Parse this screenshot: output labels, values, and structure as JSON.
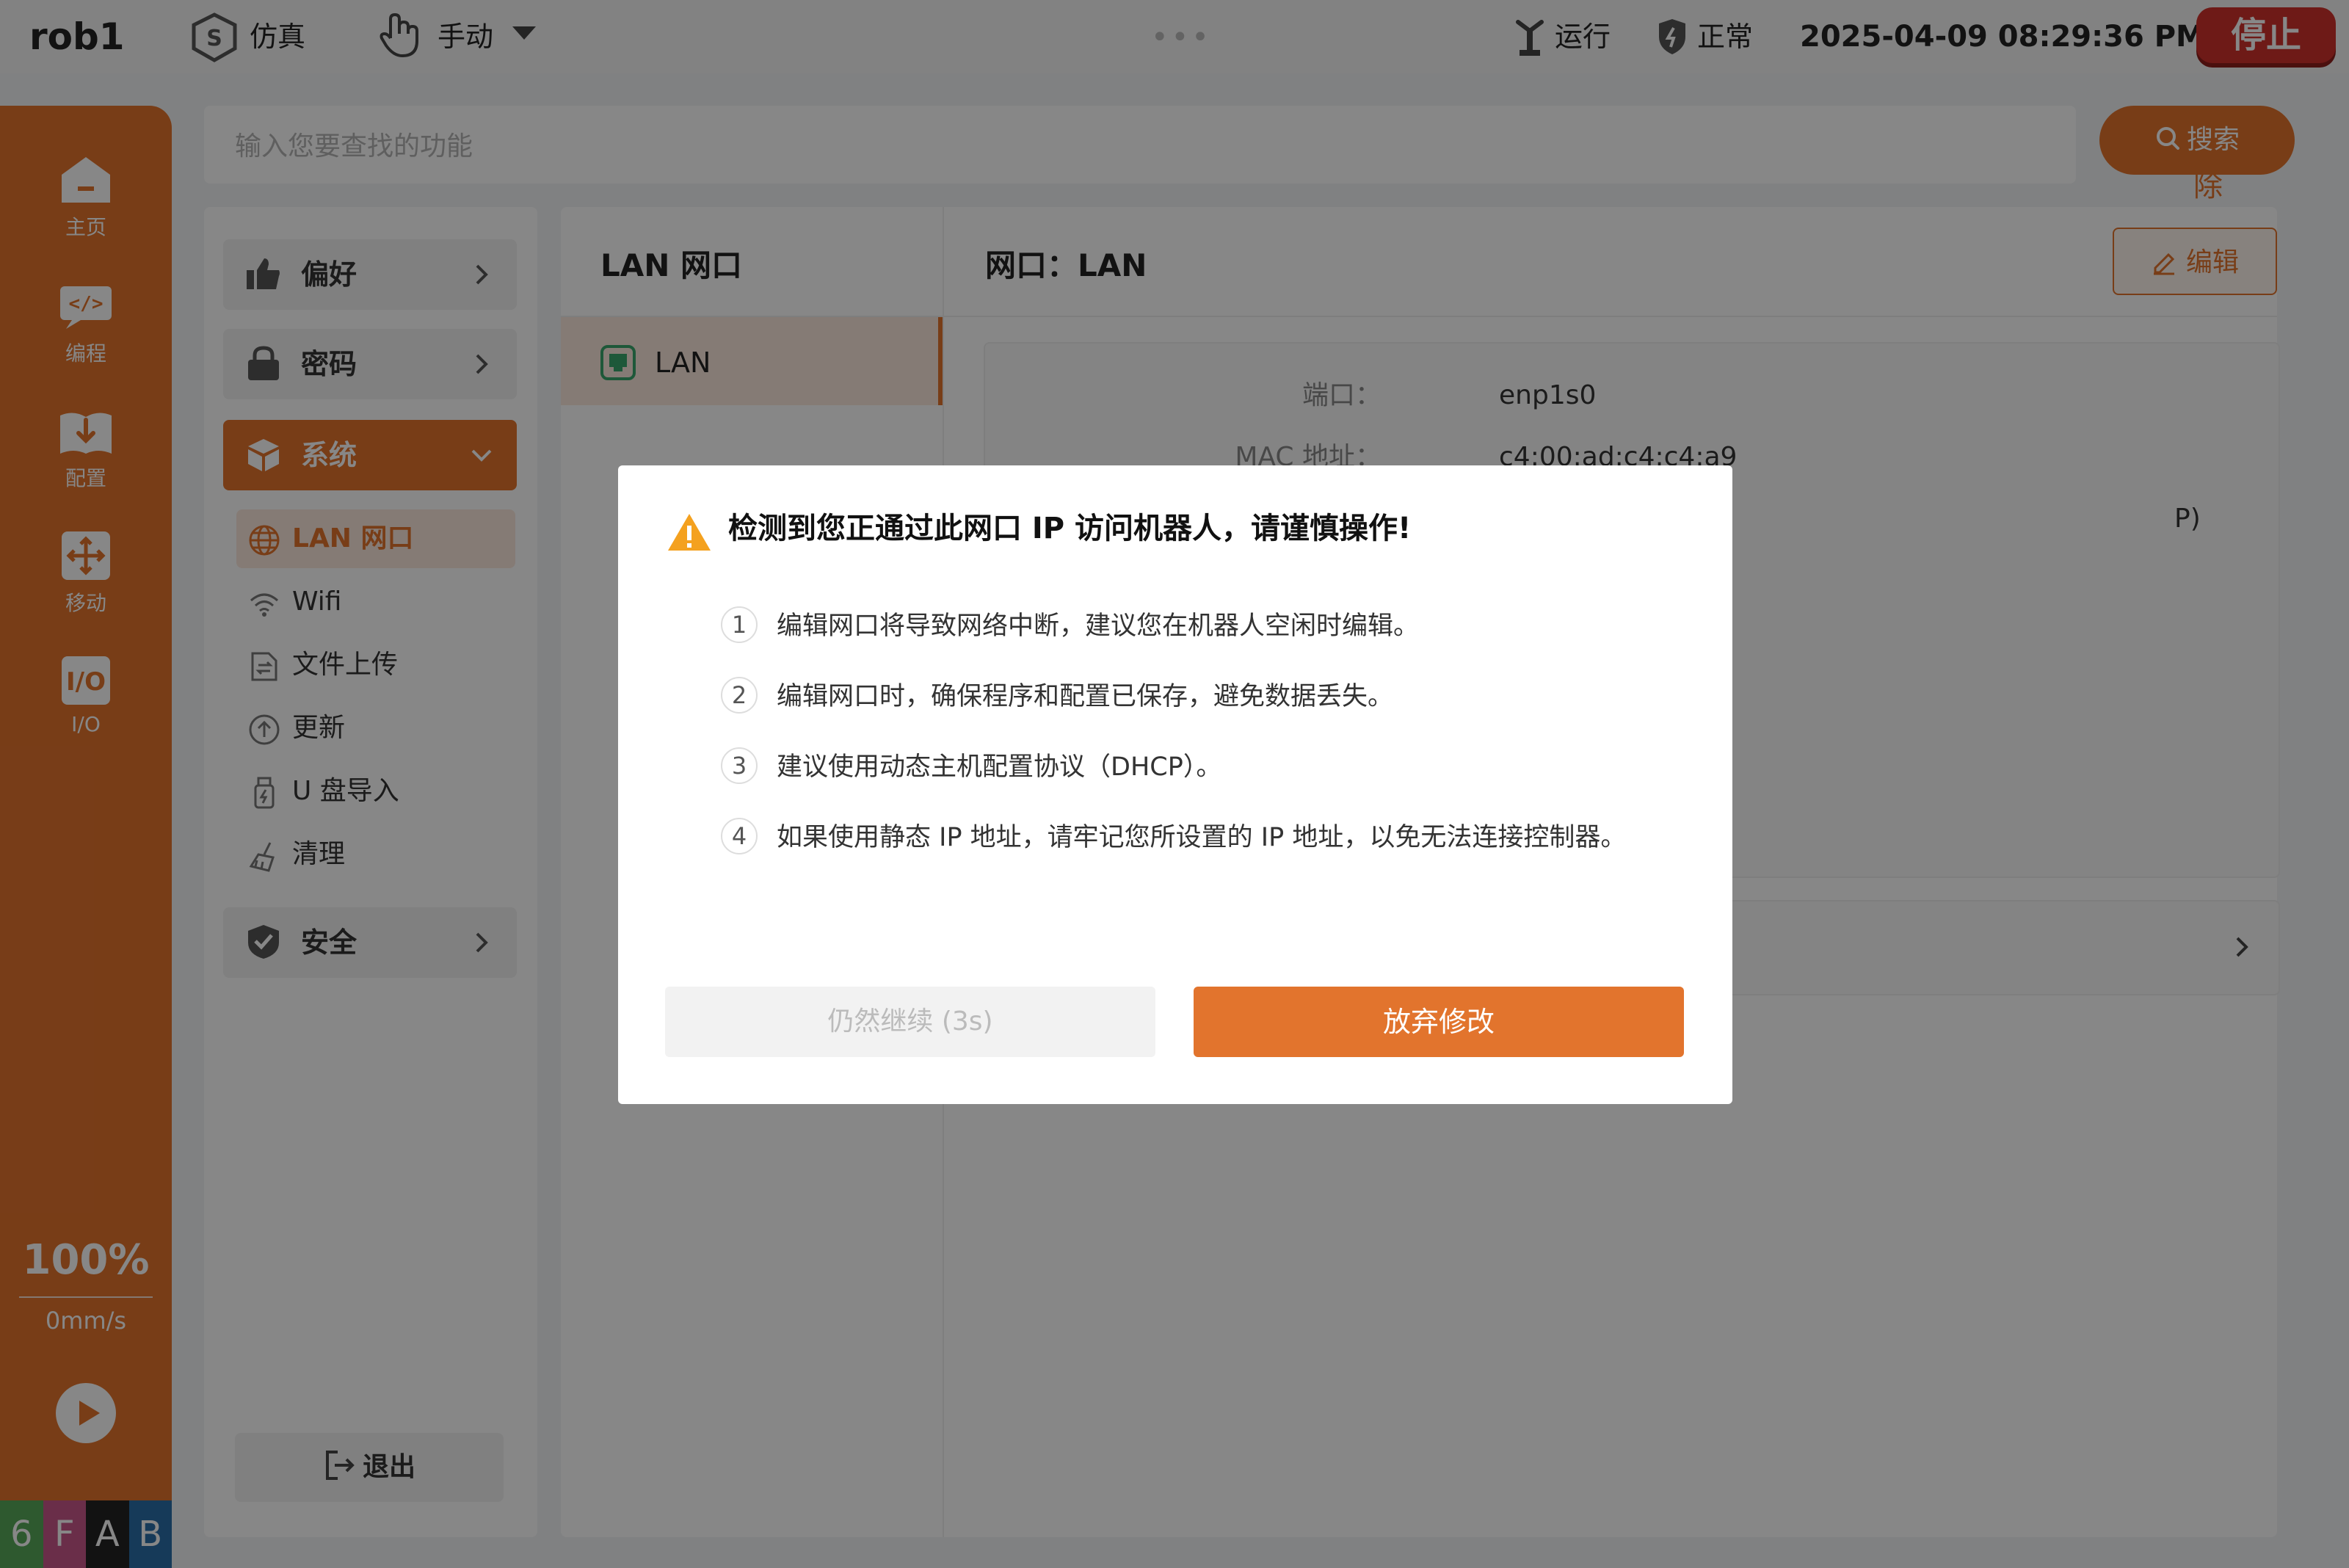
{
  "app": {
    "robot_name": "rob1",
    "stop_label": "停止"
  },
  "topbar": {
    "mode_sim": "仿真",
    "mode_manual": "手动",
    "status_run": "运行",
    "status_safety": "正常",
    "datetime": "2025-04-09 08:29:36 PM"
  },
  "sidebar": {
    "items": [
      {
        "label": "主页",
        "icon": "home-icon"
      },
      {
        "label": "编程",
        "icon": "code-icon"
      },
      {
        "label": "配置",
        "icon": "config-icon"
      },
      {
        "label": "移动",
        "icon": "move-icon"
      },
      {
        "label": "I/O",
        "icon": "io-icon"
      }
    ],
    "speed_percent": "100%",
    "speed_value": "0mm/s",
    "color_tabs": [
      {
        "label": "6",
        "color": "#58a85a"
      },
      {
        "label": "F",
        "color": "#c9578b"
      },
      {
        "label": "A",
        "color": "#222222"
      },
      {
        "label": "B",
        "color": "#2a6fa8"
      }
    ]
  },
  "search": {
    "placeholder": "输入您要查找的功能",
    "clear_label": "清除",
    "button_label": "搜索"
  },
  "settings": {
    "menus": [
      {
        "label": "偏好"
      },
      {
        "label": "密码"
      },
      {
        "label": "系统"
      },
      {
        "label": "安全"
      }
    ],
    "system_sub": [
      {
        "label": "LAN 网口"
      },
      {
        "label": "Wifi"
      },
      {
        "label": "文件上传"
      },
      {
        "label": "更新"
      },
      {
        "label": "U 盘导入"
      },
      {
        "label": "清理"
      }
    ],
    "logout_label": "退出"
  },
  "main": {
    "list_title": "LAN 网口",
    "list_item": "LAN",
    "detail_title": "网口：LAN",
    "edit_label": "编辑",
    "info": [
      {
        "key": "端口：",
        "value": "enp1s0"
      },
      {
        "key": "MAC 地址：",
        "value": "c4:00:ad:c4:c4:a9"
      }
    ],
    "partial_text": "P)"
  },
  "dialog": {
    "title": "检测到您正通过此网口 IP 访问机器人，请谨慎操作!",
    "items": [
      {
        "num": "1",
        "text": "编辑网口将导致网络中断，建议您在机器人空闲时编辑。"
      },
      {
        "num": "2",
        "text": "编辑网口时，确保程序和配置已保存，避免数据丢失。"
      },
      {
        "num": "3",
        "text": "建议使用动态主机配置协议（DHCP）。"
      },
      {
        "num": "4",
        "text": "如果使用静态 IP 地址，请牢记您所设置的 IP 地址，以免无法连接控制器。"
      }
    ],
    "continue_label": "仍然继续 (3s)",
    "abandon_label": "放弃修改"
  },
  "colors": {
    "accent": "#e2742d",
    "stop": "#d0312d"
  }
}
